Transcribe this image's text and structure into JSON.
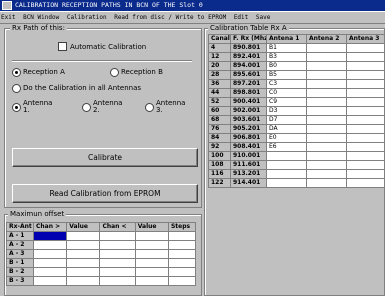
{
  "window": {
    "title": "CALIBRATION RECEPTION PATHS IN BCN OF THE Slot 0"
  },
  "menu": [
    "Exit",
    "BCN Window",
    "Calibration",
    "Read from disc / Write to EPROM",
    "Edit",
    "Save"
  ],
  "rx_path": {
    "title": "Rx Path of this:",
    "auto_calibration": "Automatic Calibration",
    "reception_a": "Reception A",
    "reception_b": "Reception B",
    "all_antennas": "Do the Calibration in all Antennas",
    "antenna_1": "Antenna 1.",
    "antenna_2": "Antenna 2.",
    "antenna_3": "Antenna 3.",
    "calibrate": "Calibrate",
    "read_eprom": "Read Calibration from EPROM"
  },
  "max_offset": {
    "title": "Maximun offset",
    "headers": [
      "Rx-Ant",
      "Chan >",
      "Value",
      "Chan <",
      "Value",
      "Steps"
    ],
    "rows": [
      "A - 1",
      "A - 2",
      "A - 3",
      "B - 1",
      "B - 2",
      "B - 3"
    ]
  },
  "cal_table": {
    "title": "Calibration Table Rx A",
    "headers": [
      "Canal",
      "F. Rx (Mhz)",
      "Antena 1",
      "Antena 2",
      "Antena 3"
    ],
    "rows": [
      [
        "4",
        "890.801",
        "B1"
      ],
      [
        "12",
        "892.401",
        "B3"
      ],
      [
        "20",
        "894.001",
        "B0"
      ],
      [
        "28",
        "895.601",
        "B5"
      ],
      [
        "36",
        "897.201",
        "C3"
      ],
      [
        "44",
        "898.801",
        "C0"
      ],
      [
        "52",
        "900.401",
        "C9"
      ],
      [
        "60",
        "902.001",
        "D3"
      ],
      [
        "68",
        "903.601",
        "D7"
      ],
      [
        "76",
        "905.201",
        "DA"
      ],
      [
        "84",
        "906.801",
        "E0"
      ],
      [
        "92",
        "908.401",
        "E6"
      ],
      [
        "100",
        "910.001",
        ""
      ],
      [
        "108",
        "911.601",
        ""
      ],
      [
        "116",
        "913.201",
        ""
      ],
      [
        "122",
        "914.401",
        ""
      ]
    ]
  }
}
